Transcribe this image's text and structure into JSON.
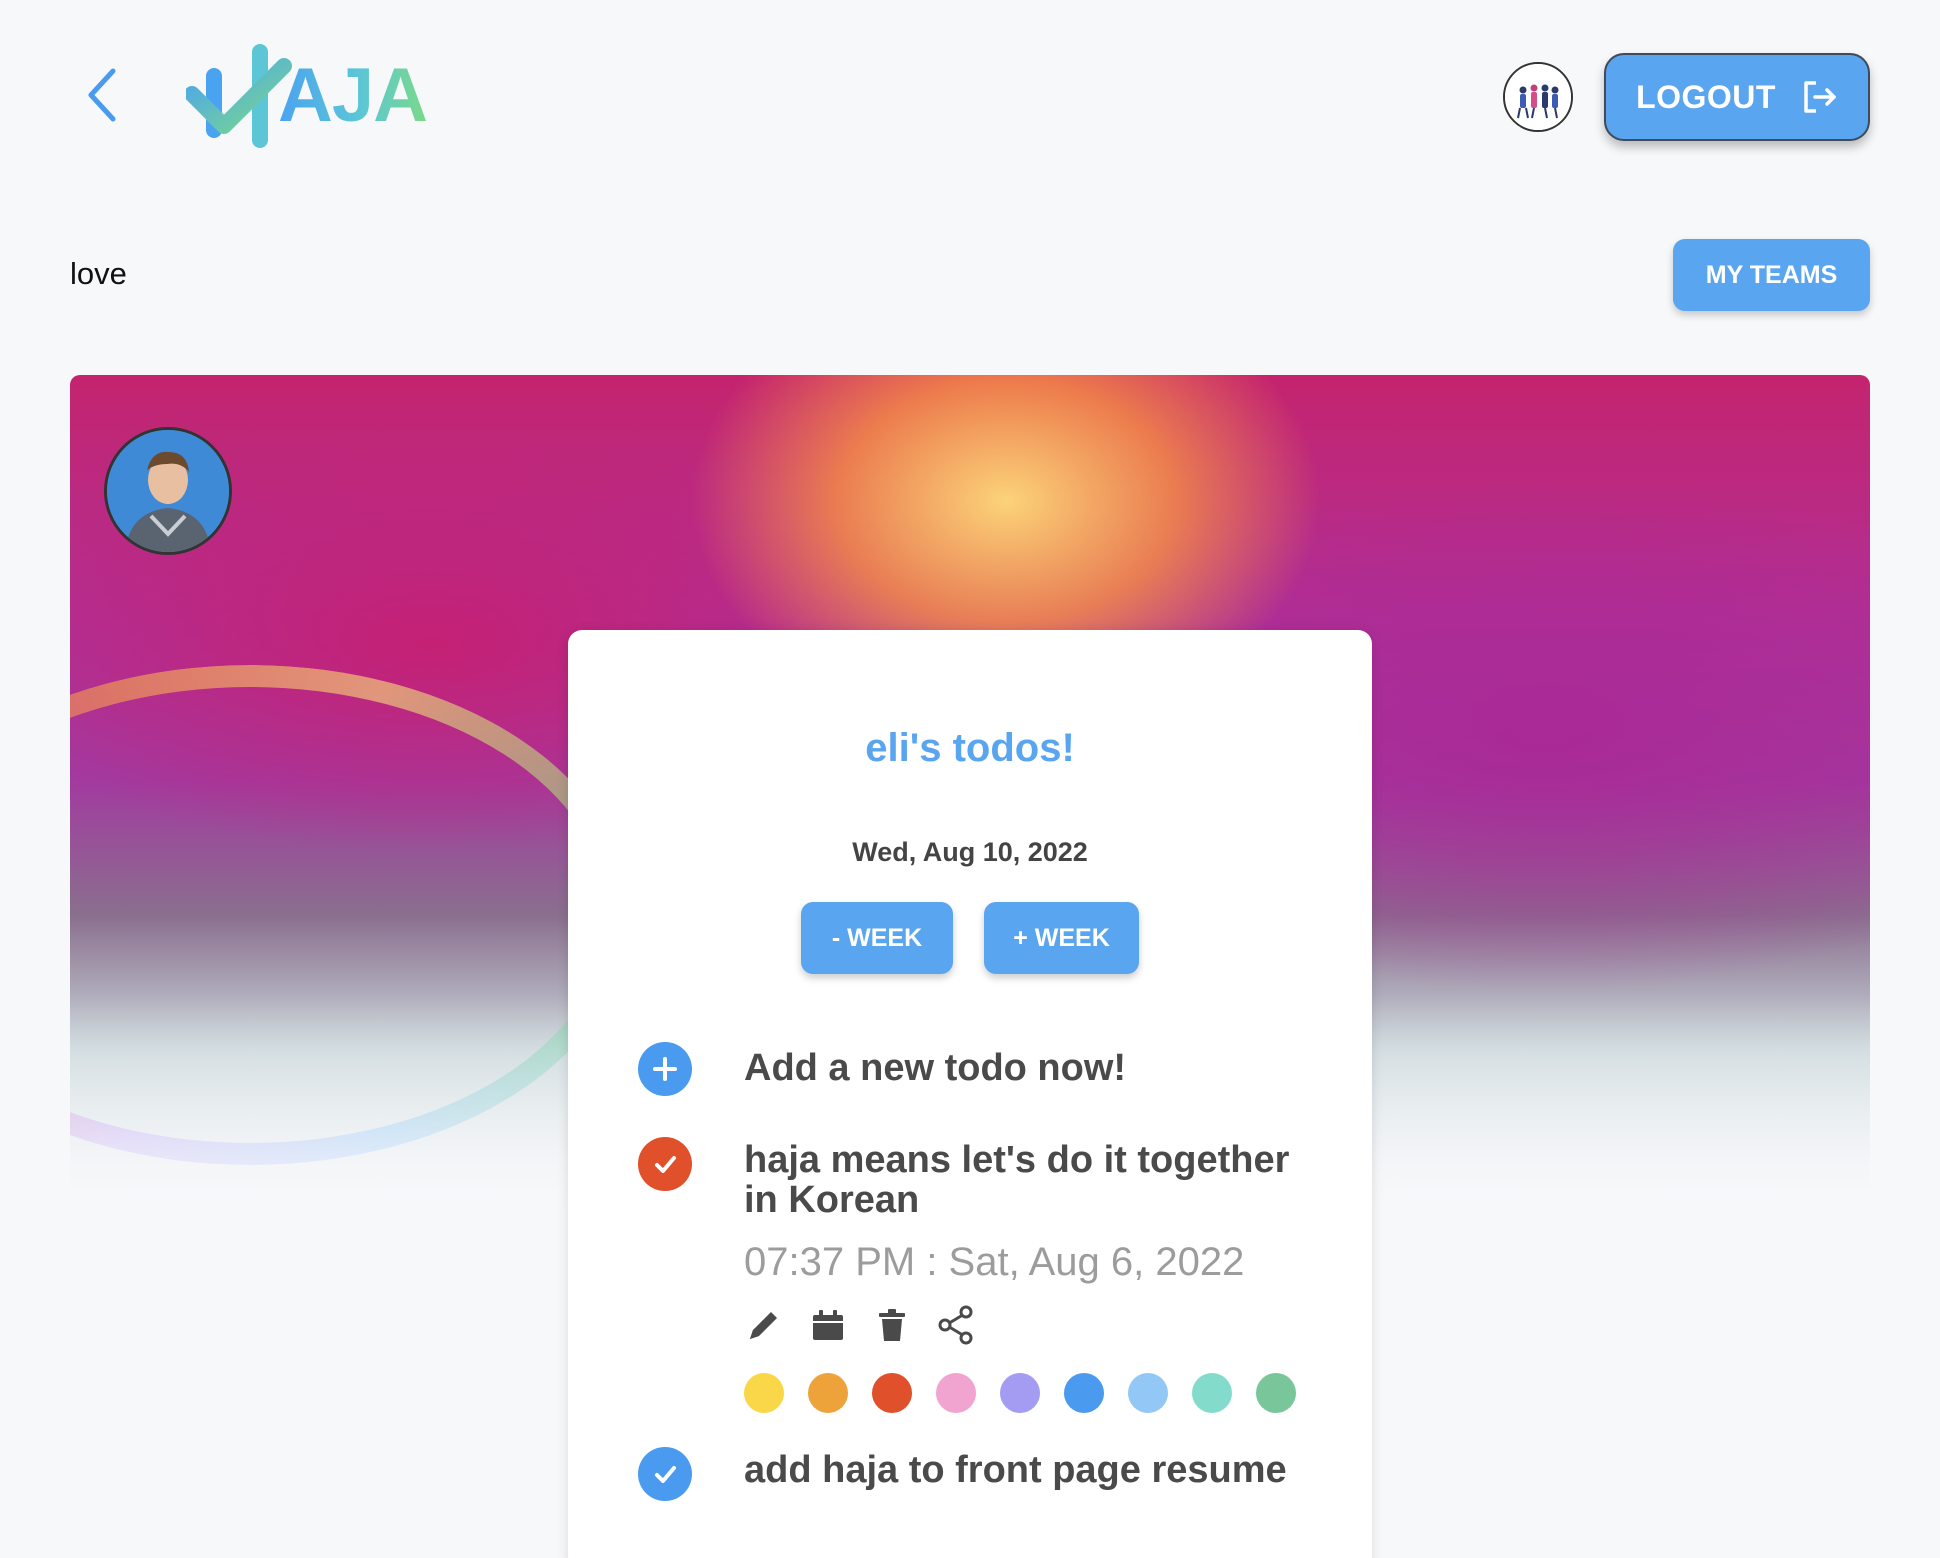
{
  "header": {
    "logo_text": "AJA",
    "logout_label": "LOGOUT"
  },
  "team": {
    "name": "love",
    "my_teams_label": "MY TEAMS"
  },
  "card": {
    "title": "eli's todos!",
    "date": "Wed, Aug 10, 2022",
    "minus_week_label": "- WEEK",
    "plus_week_label": "+ WEEK",
    "add_todo_label": "Add a new todo now!",
    "todos": [
      {
        "text": "haja means let's do it together in Korean",
        "time": "07:37 PM : Sat, Aug 6, 2022",
        "status_color": "#e0502a"
      },
      {
        "text": "add haja to front page resume",
        "status_color": "#4a9bef"
      }
    ],
    "actions": [
      "pencil-icon",
      "calendar-icon",
      "trash-icon",
      "share-icon"
    ],
    "color_options": [
      "#f9d748",
      "#eda33a",
      "#e0502a",
      "#f0a4cf",
      "#a39cf2",
      "#4a9bef",
      "#93c8f6",
      "#83dccb",
      "#7ac69b"
    ]
  },
  "colors": {
    "accent": "#5aa5ef",
    "background": "#f7f8fa"
  }
}
